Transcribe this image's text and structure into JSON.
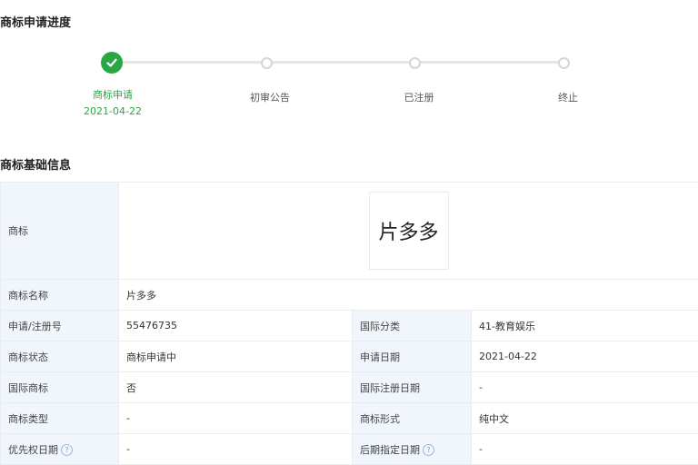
{
  "progress": {
    "title": "商标申请进度",
    "steps": [
      {
        "label": "商标申请",
        "date": "2021-04-22",
        "status": "done"
      },
      {
        "label": "初审公告",
        "status": "pending"
      },
      {
        "label": "已注册",
        "status": "pending"
      },
      {
        "label": "终止",
        "status": "pending"
      }
    ]
  },
  "basic": {
    "title": "商标基础信息",
    "logo_label": "商标",
    "logo_text": "片多多",
    "name_label": "商标名称",
    "name_value": "片多多",
    "rows": [
      {
        "l1": "申请/注册号",
        "v1": "55476735",
        "l2": "国际分类",
        "v2": "41-教育娱乐"
      },
      {
        "l1": "商标状态",
        "v1": "商标申请中",
        "l2": "申请日期",
        "v2": "2021-04-22"
      },
      {
        "l1": "国际商标",
        "v1": "否",
        "l2": "国际注册日期",
        "v2": "-"
      },
      {
        "l1": "商标类型",
        "v1": "-",
        "l2": "商标形式",
        "v2": "纯中文"
      },
      {
        "l1": "优先权日期",
        "v1": "-",
        "l2": "后期指定日期",
        "v2": "-"
      }
    ]
  },
  "colors": {
    "accent": "#27a844",
    "label_bg": "#f0f6fb"
  },
  "icons": {
    "done": "check-icon",
    "help": "help-circle-icon"
  }
}
